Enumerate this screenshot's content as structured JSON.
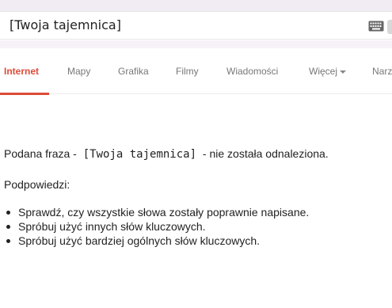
{
  "search": {
    "query": "[Twoja tajemnica]"
  },
  "icons": {
    "keyboard": "keyboard-icon"
  },
  "tabs": [
    {
      "label": "Internet",
      "active": true
    },
    {
      "label": "Mapy"
    },
    {
      "label": "Grafika"
    },
    {
      "label": "Filmy"
    },
    {
      "label": "Wiadomości"
    },
    {
      "label": "Więcej"
    },
    {
      "label": "Narz"
    }
  ],
  "colors": {
    "accent": "#dd4b39"
  },
  "result": {
    "prefix": "Podana fraza -",
    "query": "[Twoja tajemnica]",
    "suffix": "- nie została odnaleziona."
  },
  "hints": {
    "title": "Podpowiedzi:",
    "items": [
      "Sprawdź, czy wszystkie słowa zostały poprawnie napisane.",
      "Spróbuj użyć innych słów kluczowych.",
      "Spróbuj użyć bardziej ogólnych słów kluczowych."
    ]
  }
}
